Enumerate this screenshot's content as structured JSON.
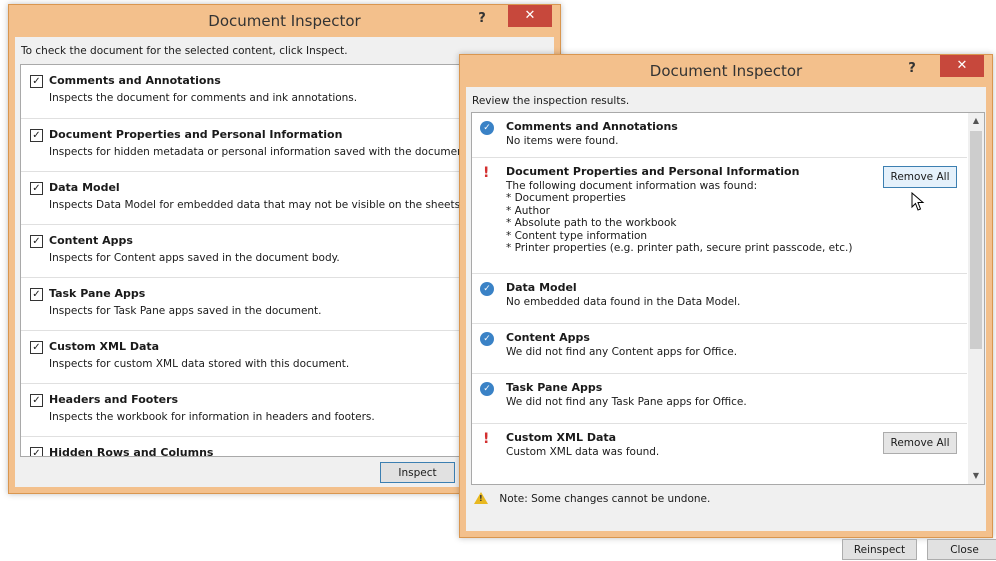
{
  "dialog1": {
    "title": "Document Inspector",
    "help": "?",
    "close": "✕",
    "instruction": "To check the document for the selected content, click Inspect.",
    "items": [
      {
        "title": "Comments and Annotations",
        "desc": "Inspects the document for comments and ink annotations."
      },
      {
        "title": "Document Properties and Personal Information",
        "desc": "Inspects for hidden metadata or personal information saved with the document."
      },
      {
        "title": "Data Model",
        "desc": "Inspects Data Model for embedded data that may not be visible on the sheets."
      },
      {
        "title": "Content Apps",
        "desc": "Inspects for Content apps saved in the document body."
      },
      {
        "title": "Task Pane Apps",
        "desc": "Inspects for Task Pane apps saved in the document."
      },
      {
        "title": "Custom XML Data",
        "desc": "Inspects for custom XML data stored with this document."
      },
      {
        "title": "Headers and Footers",
        "desc": "Inspects the workbook for information in headers and footers."
      },
      {
        "title": "Hidden Rows and Columns",
        "desc": ""
      }
    ],
    "checkmark": "✓",
    "inspect_label": "Inspect"
  },
  "dialog2": {
    "title": "Document Inspector",
    "help": "?",
    "close": "✕",
    "instruction": "Review the inspection results.",
    "results": [
      {
        "title": "Comments and Annotations",
        "lines": [
          "No items were found."
        ]
      },
      {
        "title": "Document Properties and Personal Information",
        "lines": [
          "The following document information was found:",
          "* Document properties",
          "* Author",
          "* Absolute path to the workbook",
          "* Content type information",
          "* Printer properties (e.g. printer path, secure print passcode, etc.)"
        ]
      },
      {
        "title": "Data Model",
        "lines": [
          "No embedded data found in the Data Model."
        ]
      },
      {
        "title": "Content Apps",
        "lines": [
          "We did not find any Content apps for Office."
        ]
      },
      {
        "title": "Task Pane Apps",
        "lines": [
          "We did not find any Task Pane apps for Office."
        ]
      },
      {
        "title": "Custom XML Data",
        "lines": [
          "Custom XML data was found."
        ]
      }
    ],
    "ok_glyph": "✓",
    "warn_glyph": "!",
    "remove_all_label": "Remove All",
    "note": "Note: Some changes cannot be undone.",
    "reinspect_label": "Reinspect",
    "close_label": "Close",
    "scroll_up": "▲",
    "scroll_down": "▼"
  },
  "icons": {
    "check": "checkbox-check-icon",
    "ok": "status-ok-icon",
    "warn": "status-warning-icon",
    "triangle": "warning-triangle-icon",
    "cursor": "mouse-pointer-icon"
  },
  "colors": {
    "frame": "#f3c08c",
    "close": "#c7483c",
    "ok": "#3a82c6",
    "warn": "#d32f2f"
  }
}
